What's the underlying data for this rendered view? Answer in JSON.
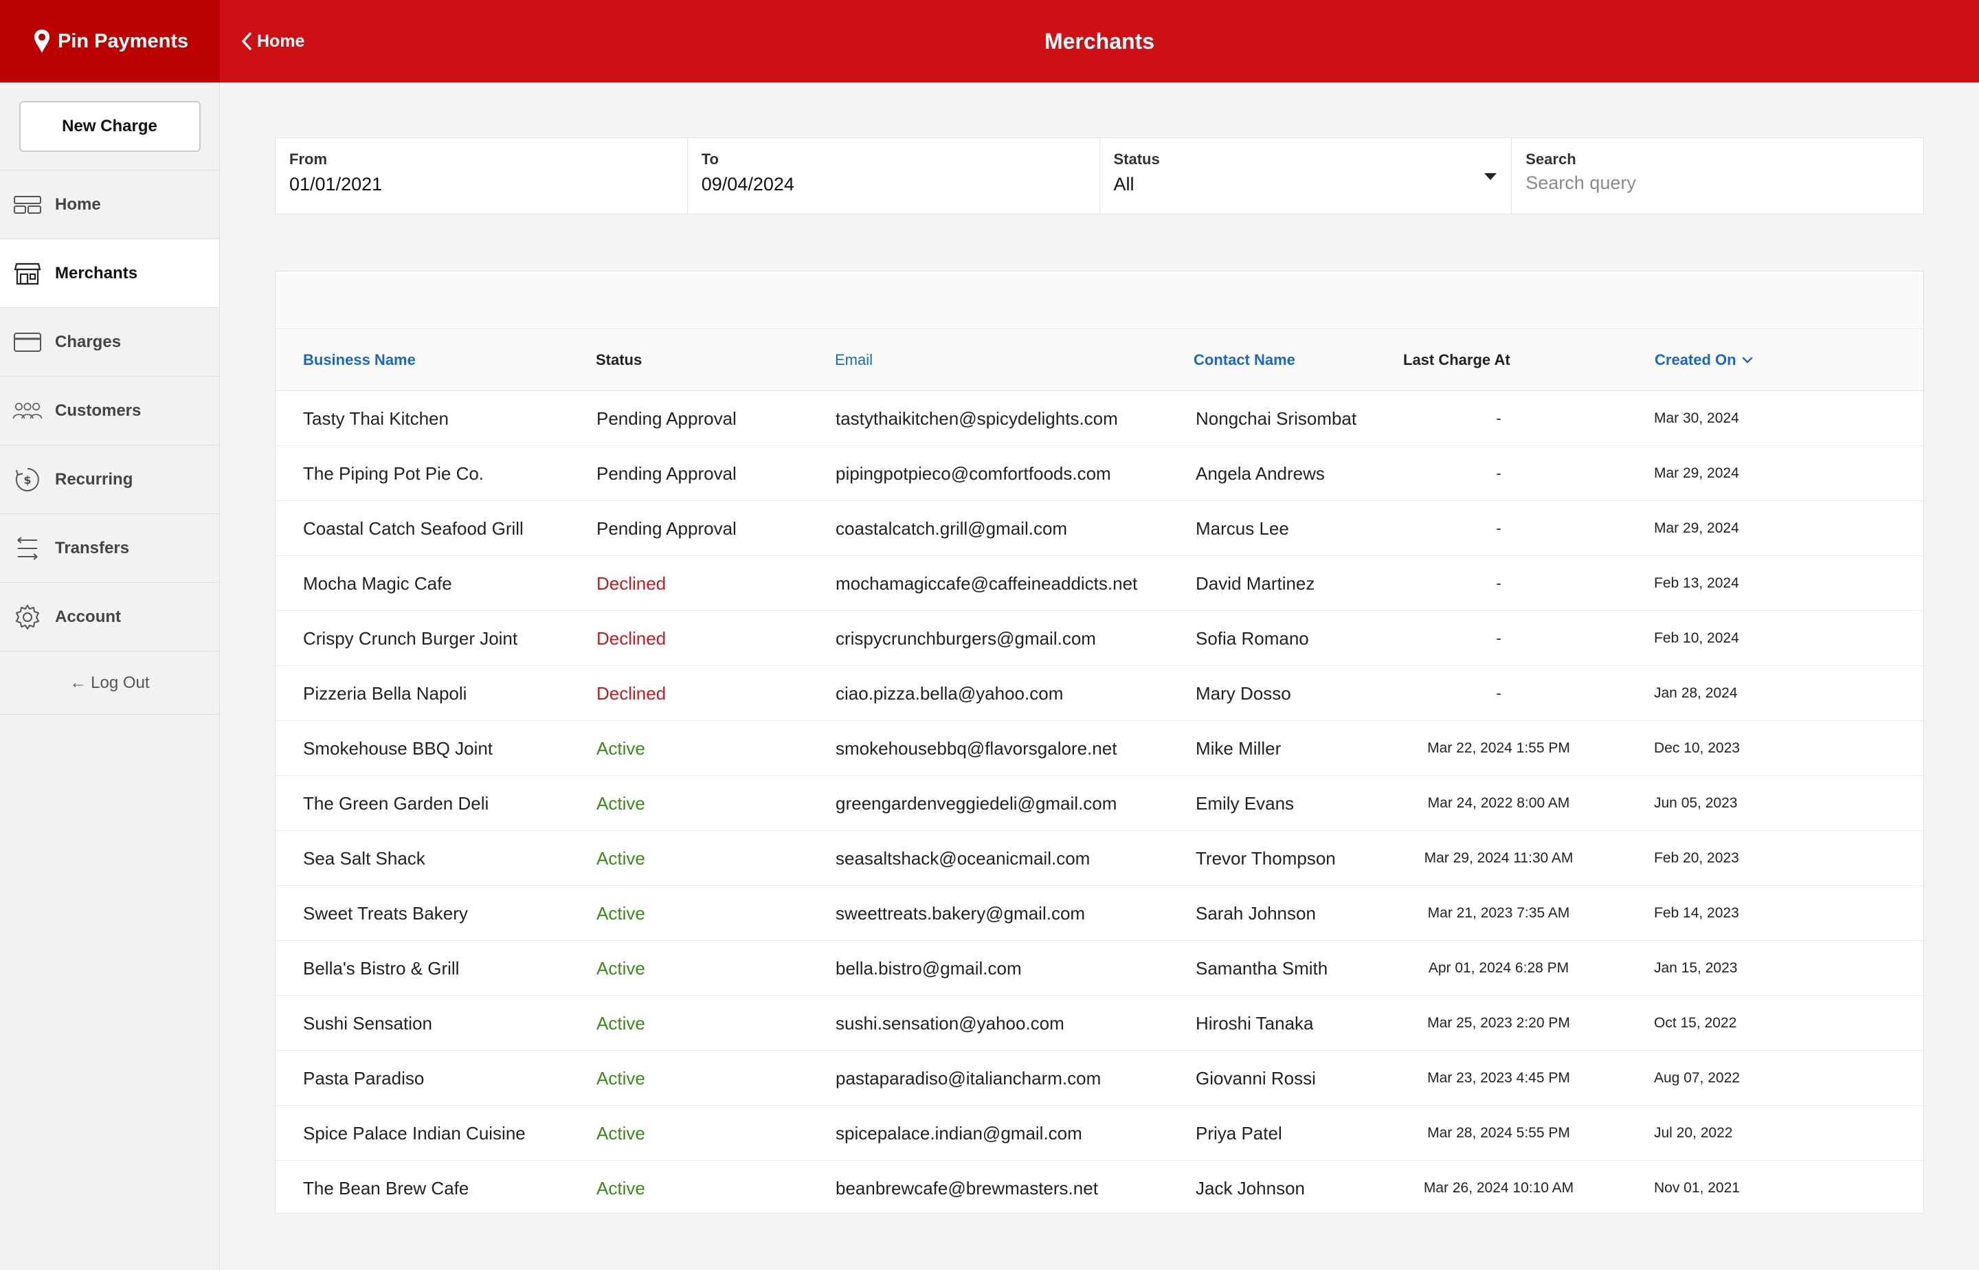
{
  "brand": {
    "name": "Pin Payments"
  },
  "header": {
    "back_label": "Home",
    "title": "Merchants"
  },
  "sidebar": {
    "new_charge_label": "New Charge",
    "items": [
      {
        "label": "Home",
        "icon": "home-icon"
      },
      {
        "label": "Merchants",
        "icon": "store-icon",
        "active": true
      },
      {
        "label": "Charges",
        "icon": "card-icon"
      },
      {
        "label": "Customers",
        "icon": "users-icon"
      },
      {
        "label": "Recurring",
        "icon": "recurring-icon"
      },
      {
        "label": "Transfers",
        "icon": "transfers-icon"
      },
      {
        "label": "Account",
        "icon": "gear-icon"
      }
    ],
    "logout_label": "← Log Out"
  },
  "filters": {
    "from": {
      "label": "From",
      "value": "01/01/2021"
    },
    "to": {
      "label": "To",
      "value": "09/04/2024"
    },
    "status": {
      "label": "Status",
      "value": "All"
    },
    "search": {
      "label": "Search",
      "placeholder": "Search query"
    }
  },
  "table": {
    "columns": [
      "Business Name",
      "Status",
      "Email",
      "Contact Name",
      "Last Charge At",
      "Created On"
    ],
    "rows": [
      [
        "Tasty Thai Kitchen",
        "Pending Approval",
        "tastythaikitchen@spicydelights.com",
        "Nongchai Srisombat",
        "-",
        "Mar 30, 2024"
      ],
      [
        "The Piping Pot Pie Co.",
        "Pending Approval",
        "pipingpotpieco@comfortfoods.com",
        "Angela Andrews",
        "-",
        "Mar 29, 2024"
      ],
      [
        "Coastal Catch Seafood Grill",
        "Pending Approval",
        "coastalcatch.grill@gmail.com",
        "Marcus Lee",
        "-",
        "Mar 29, 2024"
      ],
      [
        "Mocha Magic Cafe",
        "Declined",
        "mochamagiccafe@caffeineaddicts.net",
        "David Martinez",
        "-",
        "Feb 13, 2024"
      ],
      [
        "Crispy Crunch Burger Joint",
        "Declined",
        "crispycrunchburgers@gmail.com",
        "Sofia Romano",
        "-",
        "Feb 10, 2024"
      ],
      [
        "Pizzeria Bella Napoli",
        "Declined",
        "ciao.pizza.bella@yahoo.com",
        "Mary Dosso",
        "-",
        "Jan 28, 2024"
      ],
      [
        "Smokehouse BBQ Joint",
        "Active",
        "smokehousebbq@flavorsgalore.net",
        "Mike Miller",
        "Mar 22, 2024 1:55 PM",
        "Dec 10, 2023"
      ],
      [
        "The Green Garden Deli",
        "Active",
        "greengardenveggiedeli@gmail.com",
        "Emily Evans",
        "Mar 24, 2022 8:00 AM",
        "Jun 05, 2023"
      ],
      [
        "Sea Salt Shack",
        "Active",
        "seasaltshack@oceanicmail.com",
        "Trevor Thompson",
        "Mar 29, 2024 11:30 AM",
        "Feb 20, 2023"
      ],
      [
        "Sweet Treats Bakery",
        "Active",
        "sweettreats.bakery@gmail.com",
        "Sarah Johnson",
        "Mar 21, 2023 7:35 AM",
        "Feb 14, 2023"
      ],
      [
        "Bella's Bistro & Grill",
        "Active",
        "bella.bistro@gmail.com",
        "Samantha Smith",
        "Apr 01, 2024 6:28 PM",
        "Jan 15, 2023"
      ],
      [
        "Sushi Sensation",
        "Active",
        "sushi.sensation@yahoo.com",
        "Hiroshi Tanaka",
        "Mar 25, 2023 2:20 PM",
        "Oct 15, 2022"
      ],
      [
        "Pasta Paradiso",
        "Active",
        "pastaparadiso@italiancharm.com",
        "Giovanni Rossi",
        "Mar 23, 2023 4:45 PM",
        "Aug 07, 2022"
      ],
      [
        "Spice Palace Indian Cuisine",
        "Active",
        "spicepalace.indian@gmail.com",
        "Priya Patel",
        "Mar 28, 2024 5:55 PM",
        "Jul 20, 2022"
      ],
      [
        "The Bean Brew Cafe",
        "Active",
        "beanbrewcafe@brewmasters.net",
        "Jack Johnson",
        "Mar 26, 2024 10:10 AM",
        "Nov 01, 2021"
      ]
    ]
  },
  "colors": {
    "brand_red": "#cd1013",
    "brand_dark": "#bb0000",
    "link_blue": "#1a66c8",
    "declined": "#c81a1a",
    "active": "#3a8a1a"
  }
}
